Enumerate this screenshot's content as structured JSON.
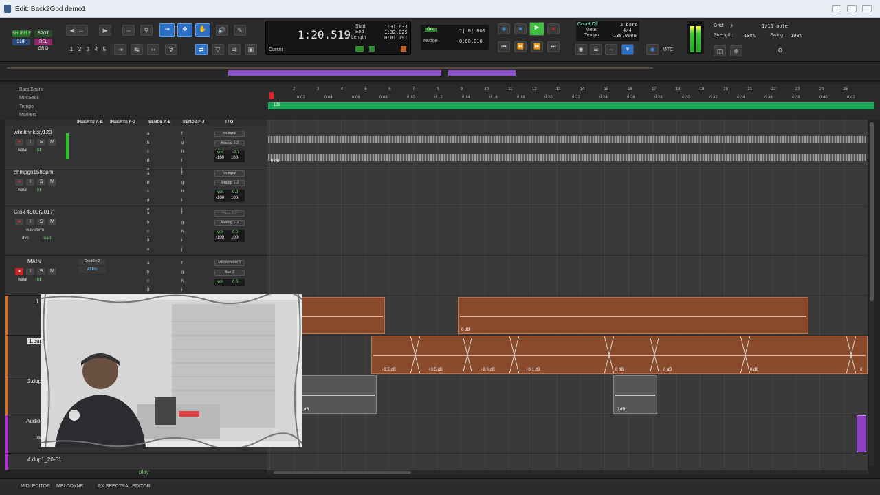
{
  "window": {
    "title": "Edit: Back2God demo1"
  },
  "toolbar": {
    "modes": [
      "SHUFFLE",
      "SPOT",
      "SLIP",
      "REL GRID"
    ],
    "zoom_presets": [
      "1",
      "2",
      "3",
      "4",
      "5"
    ],
    "counter": {
      "main": "1:20.519",
      "start_label": "Start",
      "end_label": "End",
      "length_label": "Length",
      "start": "1:31.033",
      "end": "1:32.825",
      "length": "0:01.791",
      "cursor_label": "Cursor"
    },
    "grid": {
      "label": "Grid",
      "value": "1| 0| 000",
      "nudge_label": "Nudge",
      "nudge_value": "0:00.010"
    },
    "count": {
      "countoff": "Count Off",
      "countoff_val": "2 bars",
      "meter": "Meter",
      "meter_val": "4/4",
      "tempo": "Tempo",
      "tempo_val": "138.0000",
      "mtc": "MTC"
    },
    "gridpanel": {
      "grid_label": "Grid:",
      "grid_val": "1/16 note",
      "strength_label": "Strength:",
      "strength_val": "100%",
      "swing_label": "Swing:",
      "swing_val": "100%"
    }
  },
  "rulers": {
    "bars_label": "Bars|Beats",
    "minsecs_label": "Min:Secs",
    "tempo_label": "Tempo",
    "markers_label": "Markers",
    "tempo_value": "138",
    "bar_ticks": [
      "2",
      "3",
      "4",
      "5",
      "6",
      "7",
      "8",
      "9",
      "10",
      "11",
      "12",
      "13",
      "14",
      "15",
      "16",
      "17",
      "18",
      "19",
      "20",
      "21",
      "22",
      "23",
      "24",
      "25"
    ],
    "min_ticks": [
      "0:02",
      "0:04",
      "0:06",
      "0:08",
      "0:10",
      "0:12",
      "0:14",
      "0:16",
      "0:18",
      "0:20",
      "0:22",
      "0:24",
      "0:26",
      "0:28",
      "0:30",
      "0:32",
      "0:34",
      "0:36",
      "0:38",
      "0:40",
      "0:42"
    ]
  },
  "columns": [
    "INSERTS A-E",
    "INSERTS F-J",
    "SENDS A-E",
    "SENDS F-J",
    "I / O"
  ],
  "tracks": [
    {
      "name": "whnlthnkbty120",
      "input": "no input",
      "output": "Analog 1-2",
      "vol": "-2.7",
      "pan_l": "‹100",
      "pan_r": "100›",
      "view": "wave",
      "auto": "rd"
    },
    {
      "name": "chmpgn158bpm",
      "input": "no input",
      "output": "Analog 1-2",
      "vol": "0.0",
      "pan_l": "‹100",
      "pan_r": "100›",
      "view": "wave",
      "auto": "rd"
    },
    {
      "name": "Glox 4000(2017)",
      "input": "Input 1-2",
      "output": "Analog 1-2",
      "vol": "0.0",
      "pan_l": "‹100",
      "pan_r": "100›",
      "view": "waveform",
      "auto": "read",
      "extra": "dyn"
    },
    {
      "name": "MAIN",
      "input": "Microphone 1",
      "output": "Bus 2",
      "vol": "0.0",
      "insert1": "Doubler2",
      "insert2": "ATEfx",
      "view": "wave",
      "auto": "rd"
    },
    {
      "name": "1"
    },
    {
      "name": "1.dup1"
    },
    {
      "name": "2.dup1"
    },
    {
      "name": "Audio 2",
      "view": "play"
    },
    {
      "name": "4.dup1_20-01"
    }
  ],
  "send_letters": [
    "a",
    "b",
    "c",
    "d",
    "e"
  ],
  "send_letters_fj": [
    "f",
    "g",
    "h",
    "i",
    "j"
  ],
  "clips": {
    "track1_db": "0 dB",
    "c1": "0 dB",
    "c2": [
      "+3.5 dB",
      "+3.5 dB",
      "+2.6 dB",
      "+0.1 dB",
      "0 dB",
      "0 dB",
      "0 dB",
      "0"
    ],
    "c3": [
      "0 dB",
      "0 dB"
    ]
  },
  "status": {
    "play_label": "play"
  },
  "bottom": [
    "MIDI EDITOR",
    "MELODYNE",
    "RX SPECTRAL EDITOR"
  ]
}
